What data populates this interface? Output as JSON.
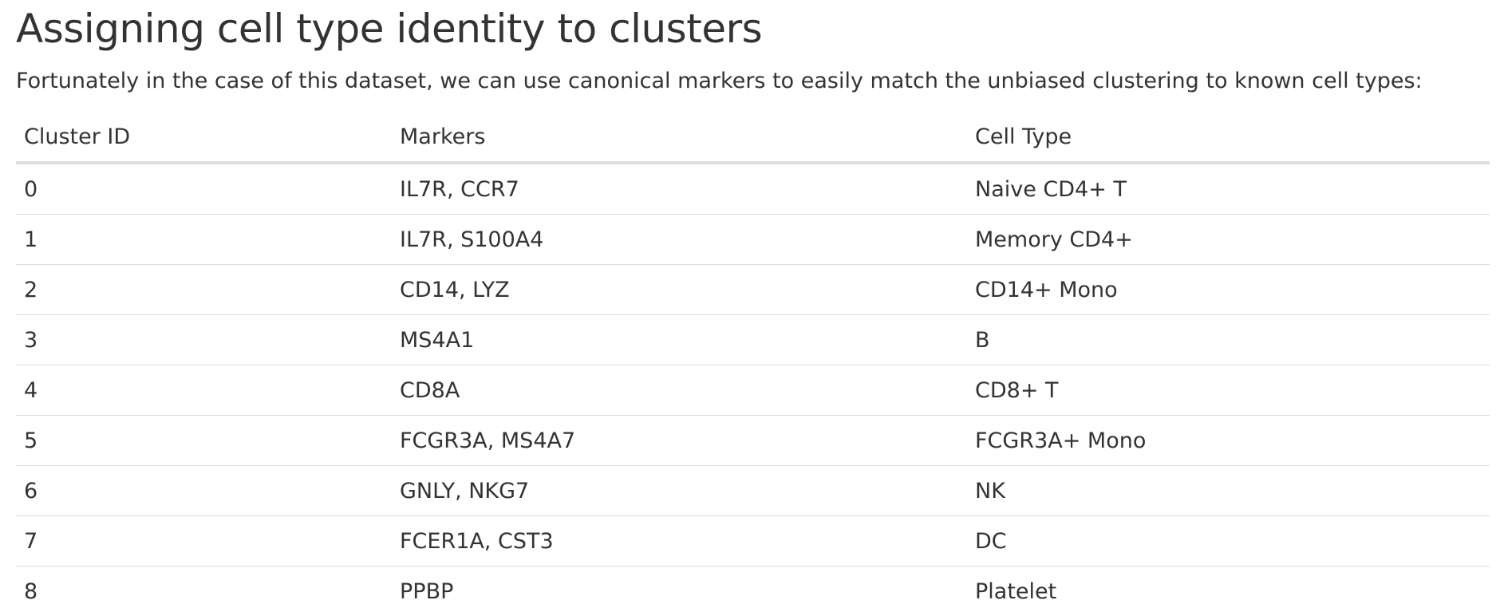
{
  "heading": "Assigning cell type identity to clusters",
  "intro": "Fortunately in the case of this dataset, we can use canonical markers to easily match the unbiased clustering to known cell types:",
  "table": {
    "headers": [
      "Cluster ID",
      "Markers",
      "Cell Type"
    ],
    "rows": [
      [
        "0",
        "IL7R, CCR7",
        "Naive CD4+ T"
      ],
      [
        "1",
        "IL7R, S100A4",
        "Memory CD4+"
      ],
      [
        "2",
        "CD14, LYZ",
        "CD14+ Mono"
      ],
      [
        "3",
        "MS4A1",
        "B"
      ],
      [
        "4",
        "CD8A",
        "CD8+ T"
      ],
      [
        "5",
        "FCGR3A, MS4A7",
        "FCGR3A+ Mono"
      ],
      [
        "6",
        "GNLY, NKG7",
        "NK"
      ],
      [
        "7",
        "FCER1A, CST3",
        "DC"
      ],
      [
        "8",
        "PPBP",
        "Platelet"
      ]
    ]
  }
}
